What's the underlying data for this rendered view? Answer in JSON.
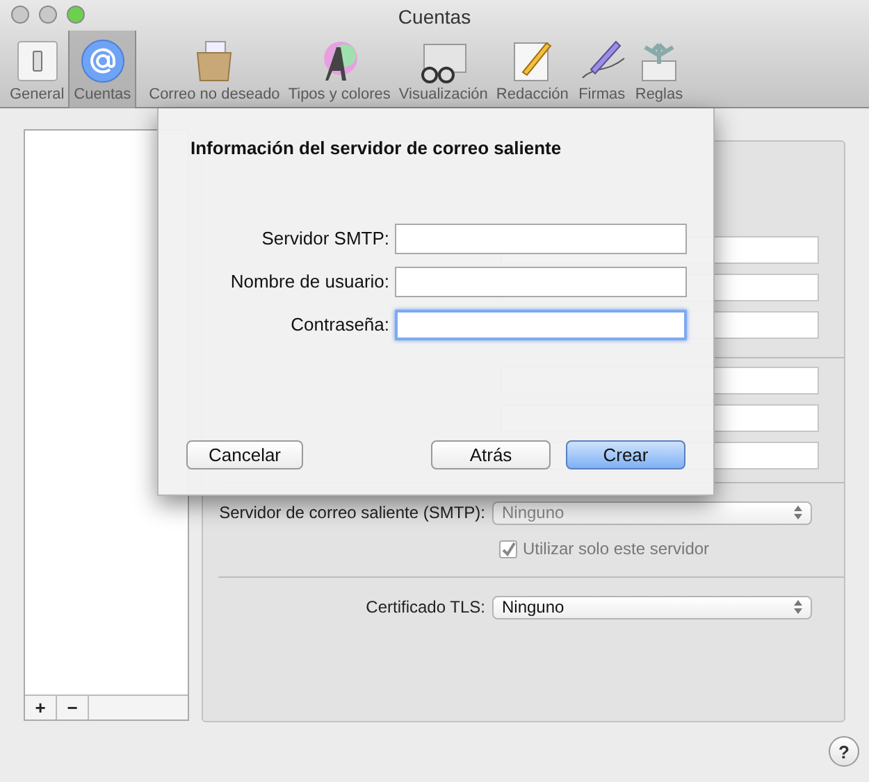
{
  "window": {
    "title": "Cuentas"
  },
  "toolbar": [
    {
      "label": "General",
      "kind": "switch",
      "selected": false
    },
    {
      "label": "Cuentas",
      "kind": "at",
      "selected": true
    },
    {
      "label": "Correo no deseado",
      "kind": "junk",
      "selected": false
    },
    {
      "label": "Tipos y colores",
      "kind": "font",
      "selected": false
    },
    {
      "label": "Visualización",
      "kind": "glasses",
      "selected": false
    },
    {
      "label": "Redacción",
      "kind": "pencil",
      "selected": false
    },
    {
      "label": "Firmas",
      "kind": "pen",
      "selected": false
    },
    {
      "label": "Reglas",
      "kind": "rules",
      "selected": false
    }
  ],
  "accounts_list": {
    "buttons": [
      "+",
      "−"
    ]
  },
  "account_panel": {
    "outgoing_server": {
      "label": "Servidor de correo saliente (SMTP):",
      "value": "Ninguno",
      "disabled": true
    },
    "only_this_server": {
      "label": "Utilizar solo este servidor",
      "checked": true,
      "disabled": true
    },
    "tls": {
      "label": "Certificado TLS:",
      "value": "Ninguno",
      "disabled": false
    }
  },
  "sheet": {
    "title": "Información del servidor de correo saliente",
    "fields": [
      {
        "label": "Servidor SMTP:",
        "focused": false
      },
      {
        "label": "Nombre de usuario:",
        "focused": false
      },
      {
        "label": "Contraseña:",
        "focused": true
      }
    ],
    "buttons": [
      {
        "label": "Cancelar",
        "kind": "cancel"
      },
      {
        "label": "Atrás",
        "kind": "secondary"
      },
      {
        "label": "Crear",
        "kind": "default"
      }
    ]
  },
  "help_button": "?"
}
